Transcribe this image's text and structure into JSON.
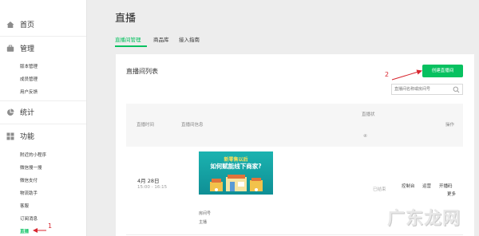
{
  "sidebar": {
    "home_label": "首页",
    "manage_label": "管理",
    "manage_items": [
      "版本管理",
      "成员管理",
      "用户反馈"
    ],
    "stats_label": "统计",
    "features_label": "功能",
    "feature_items": [
      "附近的小程序",
      "微信搜一搜",
      "微信支付",
      "物流助手",
      "客服",
      "订阅消息",
      "直播"
    ]
  },
  "page_title": "直播",
  "tabs": [
    "直播间管理",
    "商品库",
    "接入指南"
  ],
  "card": {
    "title": "直播间列表",
    "create_button": "创建直播间",
    "search_placeholder": "直播间名称或房间号"
  },
  "table": {
    "headers": {
      "time": "直播时间",
      "info": "直播间信息",
      "status_top": "直播状",
      "status_icon": "④",
      "ops": "操作"
    }
  },
  "row": {
    "date": "4月 28日",
    "time": "15:00 - 16:15",
    "cover_line1": "新零售以后",
    "cover_line2": "如何赋能线下商家?",
    "room_label": "房间号",
    "anchor_label": "主播",
    "status": "已结束",
    "ops": [
      "控制台",
      "运营",
      "开播码",
      "更多"
    ]
  },
  "annotations": {
    "step1": "1",
    "step2": "2",
    "color": "#d8262f"
  },
  "watermark": "广东龙网",
  "colors": {
    "accent": "#07c160",
    "background": "#ededed"
  }
}
